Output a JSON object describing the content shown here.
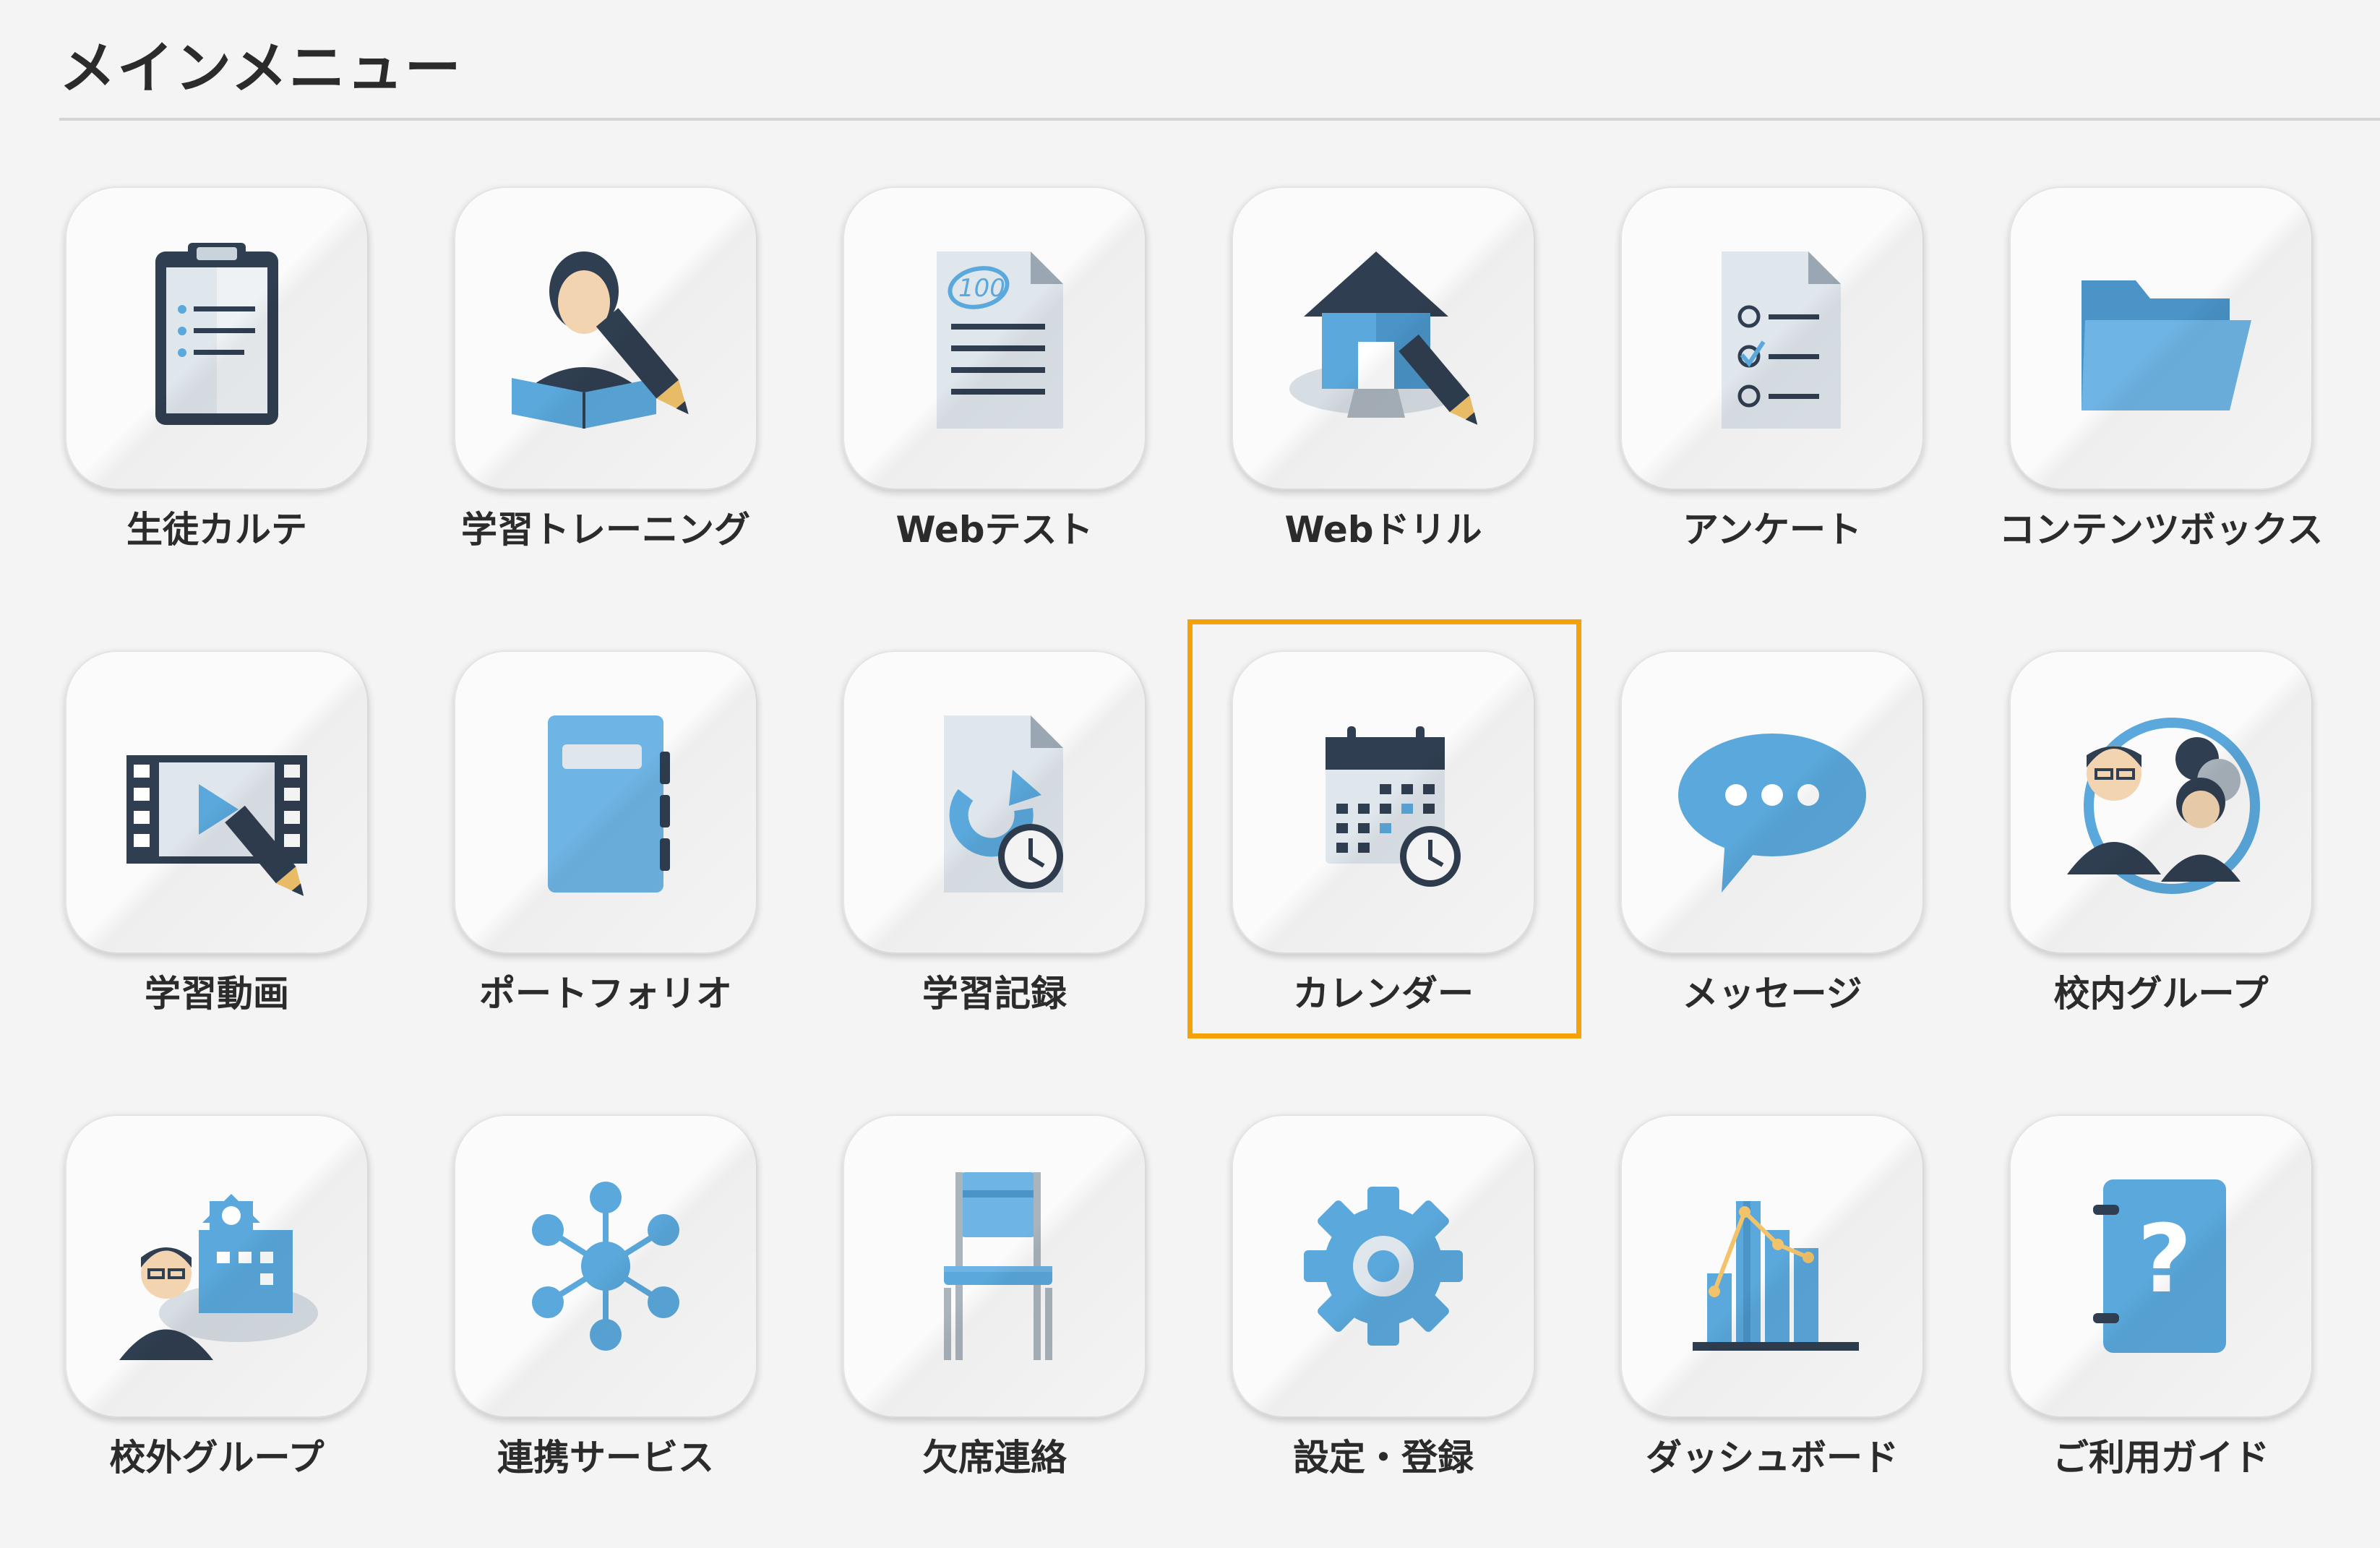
{
  "header": {
    "title": "メインメニュー"
  },
  "colors": {
    "accent_blue": "#5aa8dc",
    "dark_navy": "#2f3e50",
    "highlight": "#f5a20a"
  },
  "menu": [
    {
      "label": "生徒カルテ",
      "icon": "clipboard-icon"
    },
    {
      "label": "学習トレーニング",
      "icon": "student-writing-icon"
    },
    {
      "label": "Webテスト",
      "icon": "test-paper-icon"
    },
    {
      "label": "Webドリル",
      "icon": "home-drill-icon"
    },
    {
      "label": "アンケート",
      "icon": "checklist-icon"
    },
    {
      "label": "コンテンツボックス",
      "icon": "folder-icon"
    },
    {
      "label": "学習動画",
      "icon": "video-edit-icon"
    },
    {
      "label": "ポートフォリオ",
      "icon": "notebook-icon"
    },
    {
      "label": "学習記録",
      "icon": "record-clock-icon"
    },
    {
      "label": "カレンダー",
      "icon": "calendar-icon",
      "selected": true
    },
    {
      "label": "メッセージ",
      "icon": "chat-bubble-icon"
    },
    {
      "label": "校内グループ",
      "icon": "people-group-icon"
    },
    {
      "label": "校外グループ",
      "icon": "school-building-icon"
    },
    {
      "label": "連携サービス",
      "icon": "network-icon"
    },
    {
      "label": "欠席連絡",
      "icon": "chair-icon"
    },
    {
      "label": "設定・登録",
      "icon": "gear-icon"
    },
    {
      "label": "ダッシュボード",
      "icon": "bar-chart-icon"
    },
    {
      "label": "ご利用ガイド",
      "icon": "guide-book-icon"
    }
  ]
}
